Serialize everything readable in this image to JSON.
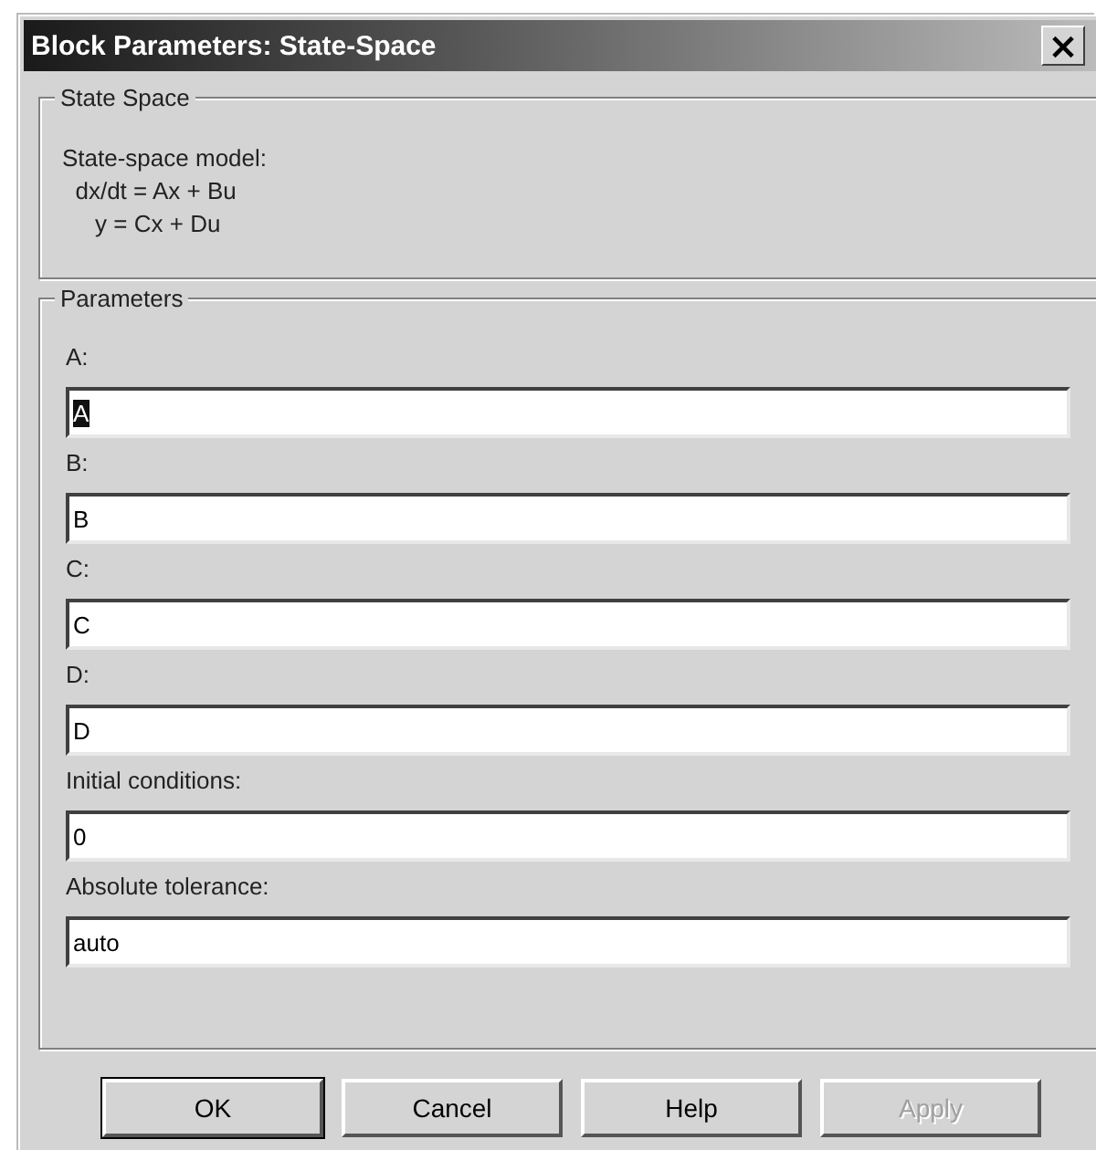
{
  "window": {
    "title": "Block Parameters: State-Space",
    "close": "×"
  },
  "description": {
    "title": "State Space",
    "lines": [
      "State-space model:",
      "  dx/dt = Ax + Bu",
      "     y = Cx + Du"
    ]
  },
  "parameters": {
    "title": "Parameters",
    "fields": [
      {
        "label": "A:",
        "value": "A",
        "text_selected": true
      },
      {
        "label": "B:",
        "value": "B",
        "text_selected": false
      },
      {
        "label": "C:",
        "value": "C",
        "text_selected": false
      },
      {
        "label": "D:",
        "value": "D",
        "text_selected": false
      },
      {
        "label": "Initial conditions:",
        "value": "0",
        "text_selected": false
      },
      {
        "label": "Absolute tolerance:",
        "value": "auto",
        "text_selected": false
      }
    ]
  },
  "buttons": [
    {
      "label": "OK",
      "default": true,
      "disabled": false
    },
    {
      "label": "Cancel",
      "default": false,
      "disabled": false
    },
    {
      "label": "Help",
      "default": false,
      "disabled": false
    },
    {
      "label": "Apply",
      "default": false,
      "disabled": true
    }
  ]
}
